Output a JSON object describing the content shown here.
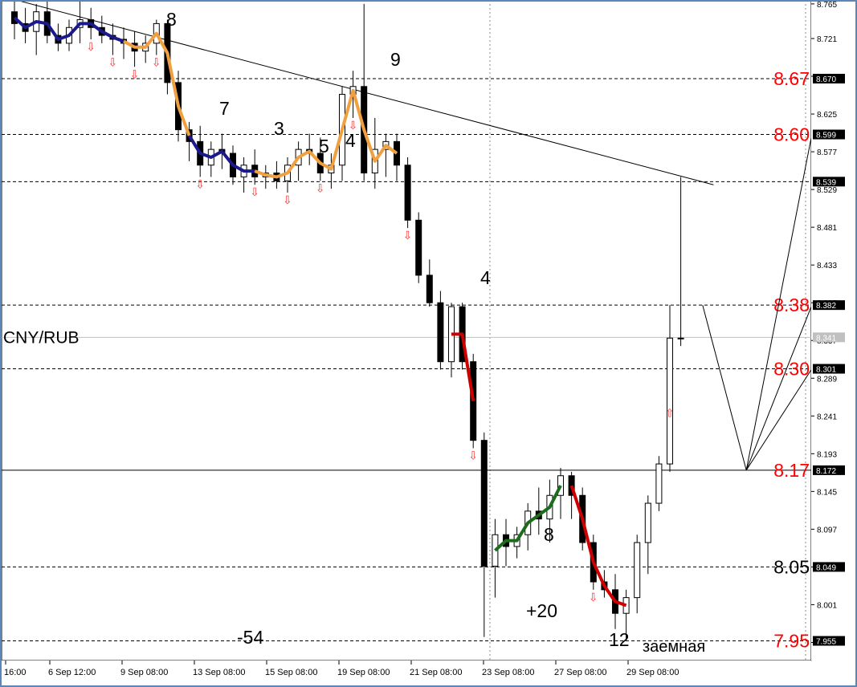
{
  "chart_data": {
    "type": "candlestick",
    "symbol": "CNY/RUB",
    "price_axis": {
      "ticks": [
        "8.765",
        "8.721",
        "8.673",
        "8.625",
        "8.577",
        "8.529",
        "8.481",
        "8.433",
        "8.385",
        "8.337",
        "8.289",
        "8.241",
        "8.193",
        "8.145",
        "8.097",
        "8.049",
        "8.001",
        "7.953"
      ],
      "current_price": "8.341",
      "ylim": [
        7.93,
        8.77
      ]
    },
    "time_axis": {
      "labels": [
        "16:00",
        "6 Sep 12:00",
        "9 Sep 08:00",
        "13 Sep 08:00",
        "15 Sep 08:00",
        "19 Sep 08:00",
        "21 Sep 08:00",
        "23 Sep 08:00",
        "27 Sep 08:00",
        "29 Sep 08:00"
      ]
    },
    "levels": [
      {
        "price": 8.67,
        "tag": "8.670",
        "label": "8.67",
        "color": "#ff0000",
        "style": "dashed"
      },
      {
        "price": 8.599,
        "tag": "8.599",
        "label": "8.60",
        "color": "#ff0000",
        "style": "dashed"
      },
      {
        "price": 8.539,
        "tag": "8.539",
        "label": "",
        "color": "#ff0000",
        "style": "dashed"
      },
      {
        "price": 8.382,
        "tag": "8.382",
        "label": "8.38",
        "color": "#ff0000",
        "style": "dashed"
      },
      {
        "price": 8.301,
        "tag": "8.301",
        "label": "8.30",
        "color": "#ff0000",
        "style": "dashed"
      },
      {
        "price": 8.172,
        "tag": "8.172",
        "label": "8.17",
        "color": "#ff0000",
        "style": "solid"
      },
      {
        "price": 8.049,
        "tag": "8.049",
        "label": "8.05",
        "color": "#000000",
        "style": "dashed"
      },
      {
        "price": 7.955,
        "tag": "7.955",
        "label": "7.95",
        "color": "#ff0000",
        "style": "dashed"
      }
    ],
    "annotations": [
      "8",
      "9",
      "7",
      "3",
      "5",
      "4",
      "4",
      "8",
      "+20",
      "-54",
      "12",
      "заемная"
    ],
    "candles": [
      [
        8.755,
        8.78,
        8.72,
        8.74
      ],
      [
        8.74,
        8.76,
        8.715,
        8.73
      ],
      [
        8.73,
        8.765,
        8.7,
        8.755
      ],
      [
        8.755,
        8.77,
        8.715,
        8.725
      ],
      [
        8.725,
        8.74,
        8.705,
        8.715
      ],
      [
        8.715,
        8.745,
        8.705,
        8.735
      ],
      [
        8.735,
        8.77,
        8.715,
        8.745
      ],
      [
        8.745,
        8.76,
        8.72,
        8.735
      ],
      [
        8.735,
        8.75,
        8.715,
        8.725
      ],
      [
        8.725,
        8.74,
        8.7,
        8.72
      ],
      [
        8.72,
        8.735,
        8.695,
        8.715
      ],
      [
        8.715,
        8.73,
        8.685,
        8.705
      ],
      [
        8.705,
        8.725,
        8.69,
        8.715
      ],
      [
        8.715,
        8.745,
        8.7,
        8.74
      ],
      [
        8.74,
        8.745,
        8.65,
        8.665
      ],
      [
        8.665,
        8.68,
        8.59,
        8.605
      ],
      [
        8.605,
        8.615,
        8.565,
        8.59
      ],
      [
        8.59,
        8.61,
        8.545,
        8.56
      ],
      [
        8.56,
        8.59,
        8.545,
        8.58
      ],
      [
        8.58,
        8.6,
        8.555,
        8.575
      ],
      [
        8.575,
        8.585,
        8.535,
        8.545
      ],
      [
        8.545,
        8.57,
        8.525,
        8.56
      ],
      [
        8.56,
        8.58,
        8.535,
        8.545
      ],
      [
        8.545,
        8.56,
        8.53,
        8.55
      ],
      [
        8.55,
        8.565,
        8.53,
        8.54
      ],
      [
        8.54,
        8.57,
        8.525,
        8.56
      ],
      [
        8.56,
        8.59,
        8.54,
        8.58
      ],
      [
        8.58,
        8.6,
        8.56,
        8.575
      ],
      [
        8.575,
        8.595,
        8.54,
        8.55
      ],
      [
        8.55,
        8.575,
        8.53,
        8.56
      ],
      [
        8.56,
        8.66,
        8.54,
        8.65
      ],
      [
        8.65,
        8.68,
        8.62,
        8.66
      ],
      [
        8.66,
        8.765,
        8.54,
        8.55
      ],
      [
        8.55,
        8.62,
        8.53,
        8.58
      ],
      [
        8.58,
        8.6,
        8.545,
        8.59
      ],
      [
        8.59,
        8.6,
        8.54,
        8.56
      ],
      [
        8.56,
        8.57,
        8.48,
        8.49
      ],
      [
        8.49,
        8.5,
        8.41,
        8.42
      ],
      [
        8.42,
        8.44,
        8.38,
        8.385
      ],
      [
        8.385,
        8.4,
        8.3,
        8.31
      ],
      [
        8.31,
        8.385,
        8.29,
        8.38
      ],
      [
        8.38,
        8.385,
        8.3,
        8.31
      ],
      [
        8.31,
        8.32,
        8.2,
        8.21
      ],
      [
        8.21,
        8.22,
        7.96,
        8.05
      ],
      [
        8.05,
        8.11,
        8.01,
        8.09
      ],
      [
        8.09,
        8.11,
        8.05,
        8.075
      ],
      [
        8.075,
        8.1,
        8.06,
        8.09
      ],
      [
        8.09,
        8.13,
        8.07,
        8.12
      ],
      [
        8.12,
        8.15,
        8.09,
        8.11
      ],
      [
        8.11,
        8.16,
        8.08,
        8.14
      ],
      [
        8.14,
        8.175,
        8.11,
        8.165
      ],
      [
        8.165,
        8.17,
        8.11,
        8.14
      ],
      [
        8.14,
        8.15,
        8.07,
        8.08
      ],
      [
        8.08,
        8.09,
        8.02,
        8.03
      ],
      [
        8.03,
        8.045,
        8.01,
        8.02
      ],
      [
        8.02,
        8.04,
        7.97,
        7.99
      ],
      [
        7.99,
        8.02,
        7.955,
        8.01
      ],
      [
        8.01,
        8.09,
        7.99,
        8.08
      ],
      [
        8.08,
        8.14,
        8.04,
        8.13
      ],
      [
        8.13,
        8.19,
        8.12,
        8.18
      ],
      [
        8.18,
        8.382,
        8.17,
        8.34
      ],
      [
        8.34,
        8.545,
        8.33,
        8.34
      ]
    ],
    "forecast_paths": [
      [
        [
          63,
          8.382
        ],
        [
          67,
          8.172
        ],
        [
          73,
          8.599
        ]
      ],
      [
        [
          67,
          8.172
        ],
        [
          73,
          8.382
        ]
      ],
      [
        [
          67,
          8.172
        ],
        [
          73,
          8.301
        ]
      ]
    ],
    "trendline": [
      [
        -8,
        8.8
      ],
      [
        64,
        8.535
      ]
    ]
  }
}
